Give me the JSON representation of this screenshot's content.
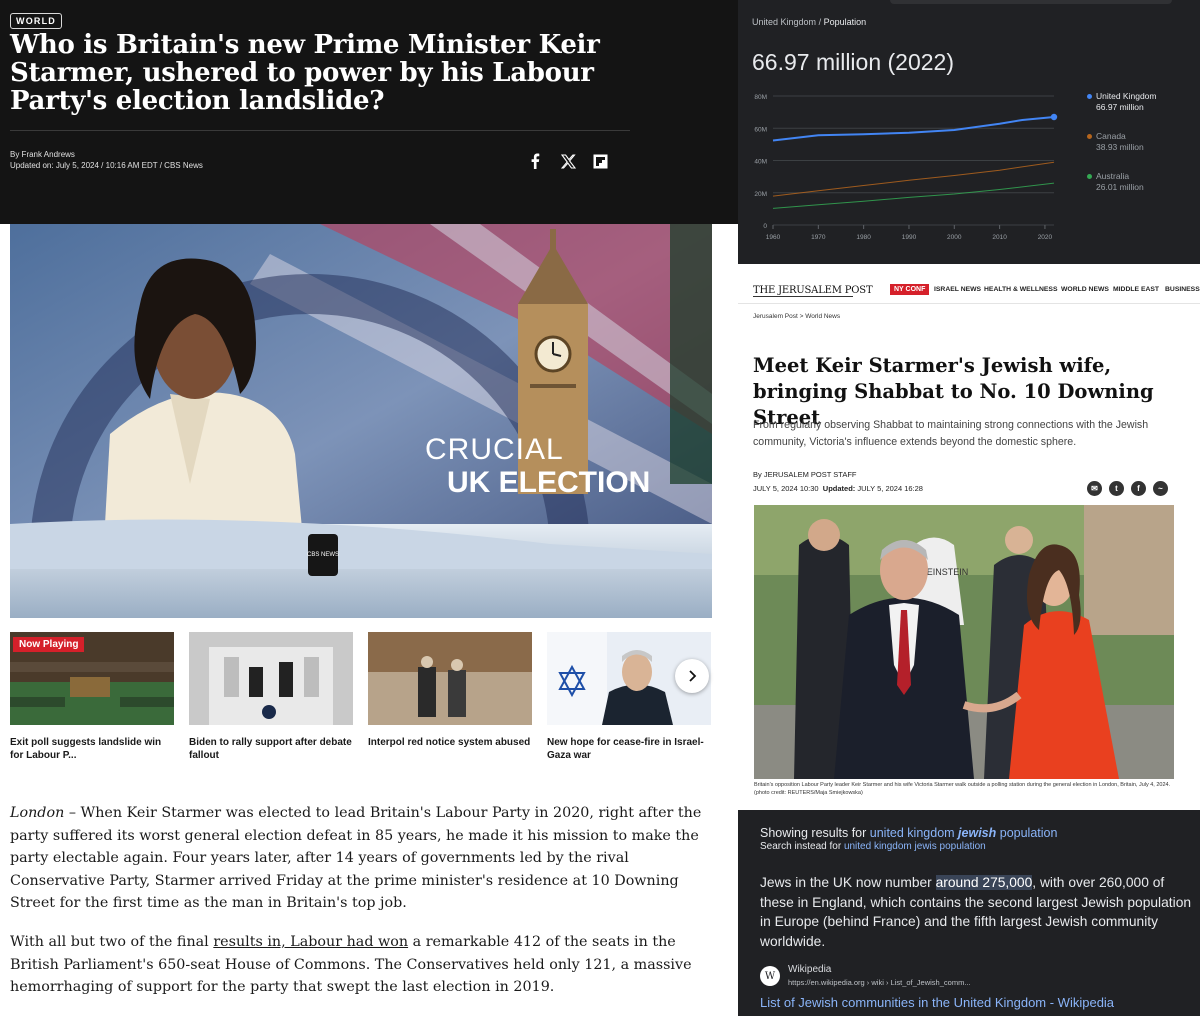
{
  "cbs": {
    "section": "WORLD",
    "headline": "Who is Britain's new Prime Minister Keir Starmer, ushered to power by his Labour Party's election landslide?",
    "byline": "By Frank Andrews",
    "updated": "Updated on: July 5, 2024 / 10:16 AM EDT / CBS News",
    "share_icons": [
      "facebook-icon",
      "x-icon",
      "flipboard-icon"
    ],
    "video": {
      "overlay_line1": "CRUCIAL",
      "overlay_line2": "UK ELECTION",
      "mug_text": "CBS NEWS"
    },
    "now_playing": "Now Playing",
    "playlist": [
      {
        "caption": "Exit poll suggests landslide win for Labour P..."
      },
      {
        "caption": "Biden to rally support after debate fallout"
      },
      {
        "caption": "Interpol red notice system abused"
      },
      {
        "caption": "New hope for cease-fire in Israel-Gaza war"
      }
    ],
    "article": {
      "p1_location": "London",
      "p1_text": " – When Keir Starmer was elected to lead Britain's Labour Party in 2020, right after the party suffered its worst general election defeat in 85 years, he made it his mission to make the party electable again. Four years later, after 14 years of governments led by the rival Conservative Party, Starmer arrived Friday at the prime minister's residence at 10 Downing Street for the first time as the man in Britain's top job.",
      "p2_before": "With all but two of the final ",
      "p2_link": "results in, Labour had won",
      "p2_after": " a remarkable 412 of the seats in the British Parliament's 650-seat House of Commons. The Conservatives held only 121, a massive hemorrhaging of support for the party that swept the last election in 2019."
    }
  },
  "population": {
    "breadcrumb_country": "United Kingdom",
    "breadcrumb_sep": "/",
    "breadcrumb_metric": "Population",
    "headline_value": "66.97 million (2022)",
    "legend": [
      {
        "name": "United Kingdom",
        "value": "66.97 million",
        "color": "#4285f4"
      },
      {
        "name": "Canada",
        "value": "38.93 million",
        "color": "#b5651d"
      },
      {
        "name": "Australia",
        "value": "26.01 million",
        "color": "#34a853"
      }
    ]
  },
  "chart_data": {
    "type": "line",
    "title": "66.97 million (2022)",
    "ylabel": "",
    "xlabel": "",
    "xlim": [
      1960,
      2022
    ],
    "ylim": [
      0,
      80
    ],
    "y_ticks": [
      "80M",
      "60M",
      "40M",
      "20M",
      "0"
    ],
    "x_ticks": [
      "1960",
      "1970",
      "1980",
      "1990",
      "2000",
      "2010",
      "2020"
    ],
    "grid": true,
    "legend_position": "right",
    "series": [
      {
        "name": "United Kingdom",
        "color": "#4285f4",
        "x": [
          1960,
          1970,
          1980,
          1990,
          2000,
          2010,
          2015,
          2022
        ],
        "y": [
          52.4,
          55.6,
          56.3,
          57.2,
          58.9,
          62.8,
          65.1,
          66.97
        ]
      },
      {
        "name": "Canada",
        "color": "#b5651d",
        "x": [
          1960,
          1970,
          1980,
          1990,
          2000,
          2010,
          2022
        ],
        "y": [
          17.9,
          21.3,
          24.5,
          27.7,
          30.7,
          34.0,
          38.93
        ]
      },
      {
        "name": "Australia",
        "color": "#34a853",
        "x": [
          1960,
          1970,
          1980,
          1990,
          2000,
          2010,
          2022
        ],
        "y": [
          10.3,
          12.5,
          14.7,
          17.1,
          19.2,
          22.0,
          26.01
        ]
      }
    ]
  },
  "jpost": {
    "logo": "THE JERUSALEM POST",
    "nav_conf": "NY CONF",
    "nav": [
      "ISRAEL NEWS",
      "HEALTH & WELLNESS",
      "WORLD NEWS",
      "MIDDLE EAST",
      "BUSINESS"
    ],
    "breadcrumb": "Jerusalem Post > World News",
    "title": "Meet Keir Starmer's Jewish wife, bringing Shabbat to No. 10 Downing Street",
    "subtitle": "From regularly observing Shabbat to maintaining strong connections with the Jewish community, Victoria's influence extends beyond the domestic sphere.",
    "author": "By JERUSALEM POST STAFF",
    "published": "JULY 5, 2024 10:30",
    "updated_label": "Updated:",
    "updated": "JULY 5, 2024 16:28",
    "share_icons": [
      "email-icon",
      "twitter-icon",
      "facebook-icon",
      "messenger-icon"
    ],
    "photo_sign_text": "VOTE EINSTEIN",
    "caption": "Britain's opposition Labour Party leader Keir Starmer and his wife Victoria Starmer walk outside a polling station during the general election in London, Britain, July 4, 2024.",
    "credit": "(photo credit: REUTERS/Maja Smiejkowska)"
  },
  "search": {
    "showing_prefix": "Showing results for ",
    "showing_before": "united kingdom ",
    "showing_bold": "jewish",
    "showing_after": " population",
    "instead_prefix": "Search instead for ",
    "instead_link": "united kingdom jewis population",
    "answer_before": "Jews in the UK now number ",
    "answer_highlight": "around 275,000",
    "answer_after": ", with over 260,000 of these in England, which contains the second largest Jewish population in Europe (behind France) and the fifth largest Jewish community worldwide.",
    "source_name": "Wikipedia",
    "source_url": "https://en.wikipedia.org › wiki › List_of_Jewish_comm...",
    "result_title": "List of Jewish communities in the United Kingdom - Wikipedia"
  }
}
